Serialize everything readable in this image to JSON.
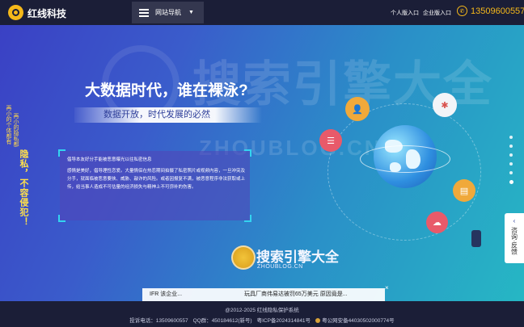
{
  "header": {
    "brand": "红线科技",
    "nav_label": "网站导航",
    "personal_login": "个人版入口",
    "enterprise_login": "企业版入口",
    "phone": "13509600557"
  },
  "watermark": {
    "cn": "搜索引擎大全",
    "en": "ZHOUBLOG.CN"
  },
  "hero": {
    "title": "大数据时代，谁在裸泳?",
    "subtitle": "数据开放，时代发展的必然"
  },
  "poem": {
    "line1": "再小的个体都有",
    "line2": "再小的隐私都",
    "line3": "隐私，不容侵犯！"
  },
  "card": {
    "heading": "倡导本友好分手能被恶意曝光以往私密信息",
    "body": "感情是美好，倡导理性恋爱。大量情侣在热恋期间拍摄了私密照片或视频内容，一旦冲突及分手，就面临被恶意要挟、威胁、敲诈的风险。或者因报复不满，被恶意程序非法获取或上传，给当事人造成不可估量的经济损失与精神上不可弥补的伤害。"
  },
  "side_tab": {
    "label": "咨询·反馈"
  },
  "center_logo": {
    "title": "搜索引擎大全",
    "subtitle": "ZHOUBLOG.CN"
  },
  "ticker": {
    "left": "IFR 该企业...",
    "right": "玩具厂商伟易达被罚65万美元 原因竟是..."
  },
  "footer": {
    "copyright": "@2012-2025 红线隐私保护系统",
    "phone_label": "投诉电话：",
    "phone": "13509600557",
    "qq_label": "QQ群：",
    "qq": "450184612(新号)",
    "icp": "粤ICP备2024314841号",
    "police": "粤公网安备44030502000774号"
  },
  "icons": [
    "menu-icon",
    "caret-down-icon",
    "phone-icon",
    "user-icon",
    "bug-icon",
    "data-icon",
    "chart-icon",
    "cloud-icon"
  ],
  "colors": {
    "header_bg": "#1b1e37",
    "accent_gold": "#f5b81a",
    "card_border": "#33d4f0"
  }
}
